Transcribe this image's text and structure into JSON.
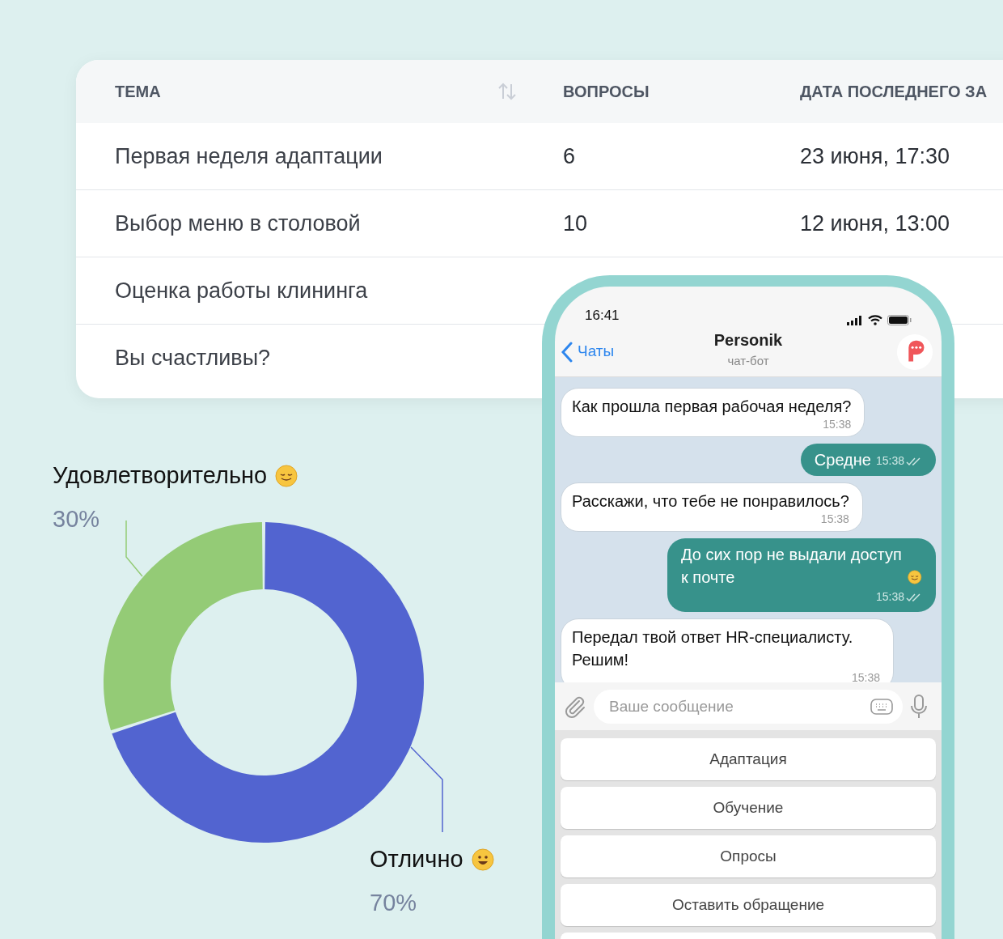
{
  "table": {
    "columns": [
      {
        "label": "ТЕМА",
        "sortable": true
      },
      {
        "label": "ВОПРОСЫ",
        "sortable": false
      },
      {
        "label": "ДАТА ПОСЛЕДНЕГО ЗА",
        "sortable": false
      }
    ],
    "rows": [
      {
        "topic": "Первая неделя адаптации",
        "questions": "6",
        "date": "23 июня, 17:30"
      },
      {
        "topic": "Выбор меню в столовой",
        "questions": "10",
        "date": "12 июня, 13:00"
      },
      {
        "topic": "Оценка работы клининга"
      },
      {
        "topic": "Вы счастливы?"
      }
    ]
  },
  "chart": {
    "chart_data": {
      "type": "donut",
      "categories": [
        "Отлично",
        "Удовлетворительно"
      ],
      "values": [
        70,
        30
      ]
    },
    "slices": [
      {
        "value_label": "70%",
        "color": "#5264d0"
      },
      {
        "value_label": "30%",
        "color": "#94cb76"
      }
    ]
  },
  "phone": {
    "status_bar": {
      "time": "16:41"
    },
    "header": {
      "back_label": "Чаты",
      "title": "Personik",
      "subtitle": "чат-бот"
    },
    "messages": [
      {
        "kind": "incoming",
        "text": "Как прошла первая рабочая неделя?",
        "time": "15:38",
        "emoji": false
      },
      {
        "kind": "outgoing",
        "text": "Средне",
        "time": "15:38",
        "emoji": false
      },
      {
        "kind": "incoming",
        "text": "Расскажи, что тебе не понравилось?",
        "time": "15:38",
        "emoji": false
      },
      {
        "kind": "outgoing",
        "text": "До сих пор не выдали доступ к почте",
        "time": "15:38",
        "emoji": true
      },
      {
        "kind": "incoming",
        "text": "Передал твой ответ HR-специалисту. Решим!",
        "time": "15:38",
        "emoji": false
      }
    ],
    "composer": {
      "placeholder": "Ваше сообщение"
    },
    "quick_replies": [
      "Адаптация",
      "Обучение",
      "Опросы",
      "Оставить обращение"
    ]
  }
}
